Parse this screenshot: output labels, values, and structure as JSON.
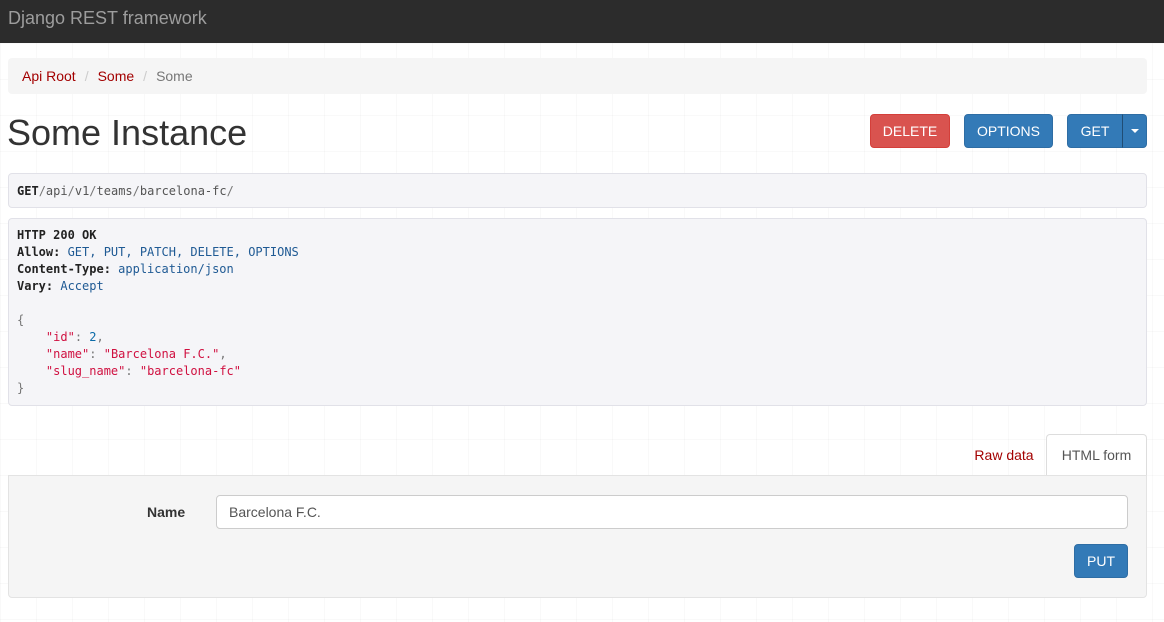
{
  "navbar": {
    "brand": "Django REST framework"
  },
  "breadcrumb": {
    "items": [
      {
        "label": "Api Root"
      },
      {
        "label": "Some"
      },
      {
        "label": "Some"
      }
    ],
    "separator": "/"
  },
  "page": {
    "title": "Some Instance"
  },
  "actions": {
    "delete_label": "DELETE",
    "options_label": "OPTIONS",
    "get_label": "GET"
  },
  "request": {
    "method": "GET",
    "path_segments": [
      "api",
      "v1",
      "teams",
      "barcelona-fc"
    ]
  },
  "response": {
    "status": "HTTP 200 OK",
    "headers": [
      {
        "name": "Allow",
        "value": "GET, PUT, PATCH, DELETE, OPTIONS"
      },
      {
        "name": "Content-Type",
        "value": "application/json"
      },
      {
        "name": "Vary",
        "value": "Accept"
      }
    ],
    "body": [
      {
        "key": "\"id\"",
        "value": "2",
        "type": "number",
        "comma": true
      },
      {
        "key": "\"name\"",
        "value": "\"Barcelona F.C.\"",
        "type": "string",
        "comma": true
      },
      {
        "key": "\"slug_name\"",
        "value": "\"barcelona-fc\"",
        "type": "string",
        "comma": false
      }
    ]
  },
  "tabs": {
    "raw_label": "Raw data",
    "html_label": "HTML form",
    "active": "HTML form"
  },
  "form": {
    "name_label": "Name",
    "name_value": "Barcelona F.C.",
    "put_label": "PUT"
  },
  "colors": {
    "navbar_bg": "#2c2c2c",
    "link": "#a30000",
    "primary": "#337ab7",
    "danger": "#d9534f"
  }
}
